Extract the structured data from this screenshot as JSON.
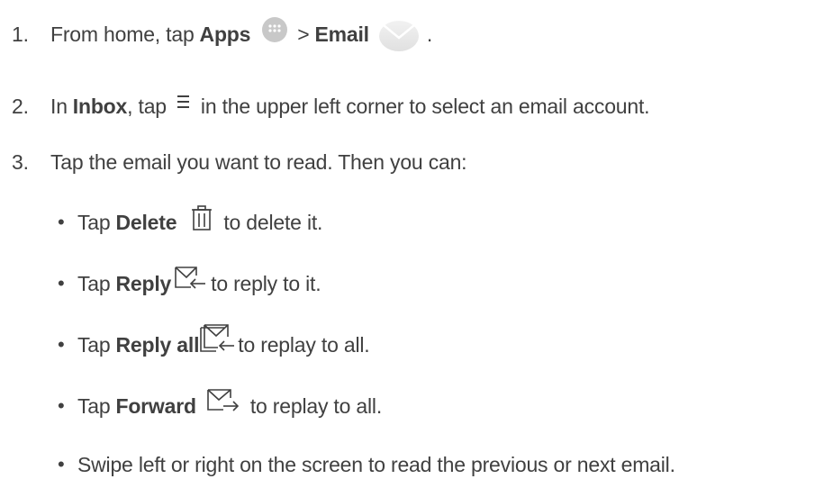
{
  "steps": [
    {
      "number": "1.",
      "prefix": "From home, tap",
      "bold1": "Apps",
      "middle": ">",
      "bold2": "Email",
      "suffix": ".",
      "icons": [
        "apps-icon",
        "email-app-icon"
      ]
    },
    {
      "number": "2.",
      "prefix": "In",
      "bold1": "Inbox",
      "middle": ", tap",
      "suffix": "in the upper left corner to select an email account.",
      "icons": [
        "menu-icon"
      ]
    },
    {
      "number": "3.",
      "text": "Tap the email you want to read. Then you can:"
    }
  ],
  "bullets": [
    {
      "marker": "•",
      "prefix": "Tap",
      "bold": "Delete",
      "suffix": "to delete it.",
      "icon": "trash-icon"
    },
    {
      "marker": "•",
      "prefix": "Tap",
      "bold": "Reply",
      "suffix": "to reply to it.",
      "icon": "reply-icon"
    },
    {
      "marker": "•",
      "prefix": "Tap",
      "bold": "Reply all",
      "suffix": "to replay to all.",
      "icon": "reply-all-icon"
    },
    {
      "marker": "•",
      "prefix": "Tap",
      "bold": "Forward",
      "suffix": "to replay to all.",
      "icon": "forward-icon"
    },
    {
      "marker": "•",
      "text": "Swipe left or right on the screen to read the previous or next email."
    }
  ]
}
